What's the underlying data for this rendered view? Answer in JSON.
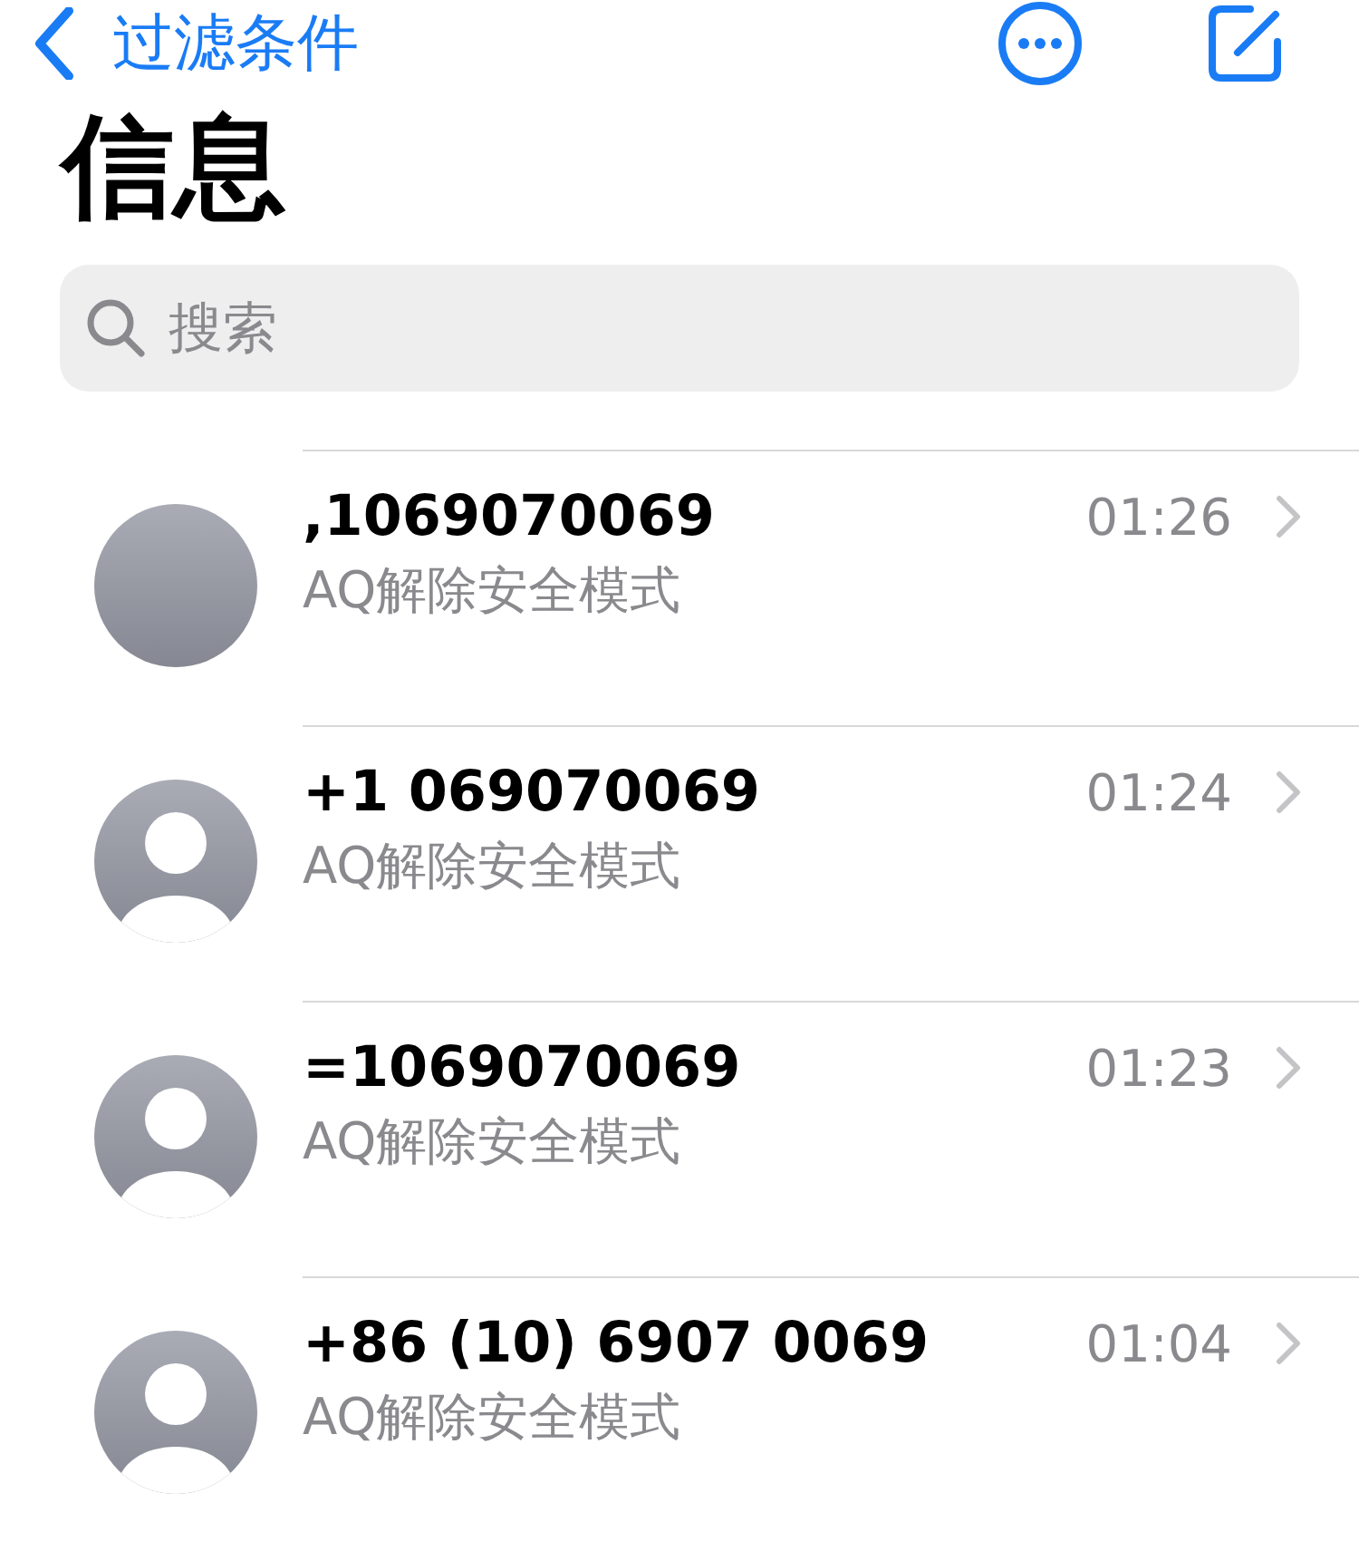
{
  "nav": {
    "back_label": "过滤条件"
  },
  "title": "信息",
  "search": {
    "placeholder": "搜索"
  },
  "conversations": [
    {
      "kind": "blank",
      "name": ",1069070069",
      "preview": "AQ解除安全模式",
      "time": "01:26"
    },
    {
      "kind": "person",
      "name": "+1 069070069",
      "preview": "AQ解除安全模式",
      "time": "01:24"
    },
    {
      "kind": "person",
      "name": "=1069070069",
      "preview": "AQ解除安全模式",
      "time": "01:23"
    },
    {
      "kind": "person",
      "name": "+86 (10) 6907 0069",
      "preview": "AQ解除安全模式",
      "time": "01:04"
    }
  ]
}
